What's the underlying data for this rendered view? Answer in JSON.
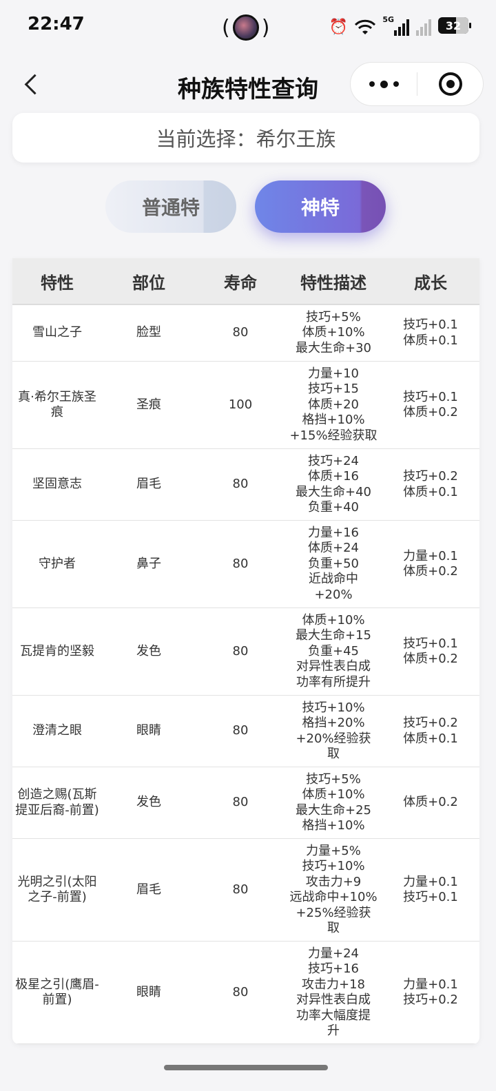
{
  "status": {
    "time": "22:47",
    "network": "5G",
    "battery": "32"
  },
  "nav": {
    "title": "种族特性查询"
  },
  "selection": {
    "label": "当前选择：",
    "value": "希尔王族"
  },
  "tabs": [
    {
      "label": "普通特"
    },
    {
      "label": "神特"
    }
  ],
  "table": {
    "headers": [
      "特性",
      "部位",
      "寿命",
      "特性描述",
      "成长"
    ],
    "rows": [
      {
        "name": "雪山之子",
        "part": "脸型",
        "life": "80",
        "desc": [
          "技巧+5%",
          "体质+10%",
          "最大生命+30"
        ],
        "growth": [
          "技巧+0.1",
          "体质+0.1"
        ]
      },
      {
        "name": "真·希尔王族圣痕",
        "part": "圣痕",
        "life": "100",
        "desc": [
          "力量+10",
          "技巧+15",
          "体质+20",
          "格挡+10%",
          "+15%经验获取"
        ],
        "growth": [
          "技巧+0.1",
          "体质+0.2"
        ]
      },
      {
        "name": "坚固意志",
        "part": "眉毛",
        "life": "80",
        "desc": [
          "技巧+24",
          "体质+16",
          "最大生命+40",
          "负重+40"
        ],
        "growth": [
          "技巧+0.2",
          "体质+0.1"
        ]
      },
      {
        "name": "守护者",
        "part": "鼻子",
        "life": "80",
        "desc": [
          "力量+16",
          "体质+24",
          "负重+50",
          "近战命中",
          "+20%"
        ],
        "growth": [
          "力量+0.1",
          "体质+0.2"
        ]
      },
      {
        "name": "瓦提肯的坚毅",
        "part": "发色",
        "life": "80",
        "desc": [
          "体质+10%",
          "最大生命+15",
          "负重+45",
          "对异性表白成",
          "功率有所提升"
        ],
        "growth": [
          "技巧+0.1",
          "体质+0.2"
        ]
      },
      {
        "name": "澄清之眼",
        "part": "眼睛",
        "life": "80",
        "desc": [
          "技巧+10%",
          "格挡+20%",
          "+20%经验获",
          "取"
        ],
        "growth": [
          "技巧+0.2",
          "体质+0.1"
        ]
      },
      {
        "name": "创造之赐(瓦斯提亚后裔-前置)",
        "part": "发色",
        "life": "80",
        "desc": [
          "技巧+5%",
          "体质+10%",
          "最大生命+25",
          "格挡+10%"
        ],
        "growth": [
          "体质+0.2"
        ]
      },
      {
        "name": "光明之引(太阳之子-前置)",
        "part": "眉毛",
        "life": "80",
        "desc": [
          "力量+5%",
          "技巧+10%",
          "攻击力+9",
          "远战命中+10%",
          "+25%经验获",
          "取"
        ],
        "growth": [
          "力量+0.1",
          "技巧+0.1"
        ]
      },
      {
        "name": "极星之引(鹰眉-前置)",
        "part": "眼睛",
        "life": "80",
        "desc": [
          "力量+24",
          "技巧+16",
          "攻击力+18",
          "对异性表白成",
          "功率大幅度提",
          "升"
        ],
        "growth": [
          "力量+0.1",
          "技巧+0.2"
        ]
      }
    ]
  }
}
